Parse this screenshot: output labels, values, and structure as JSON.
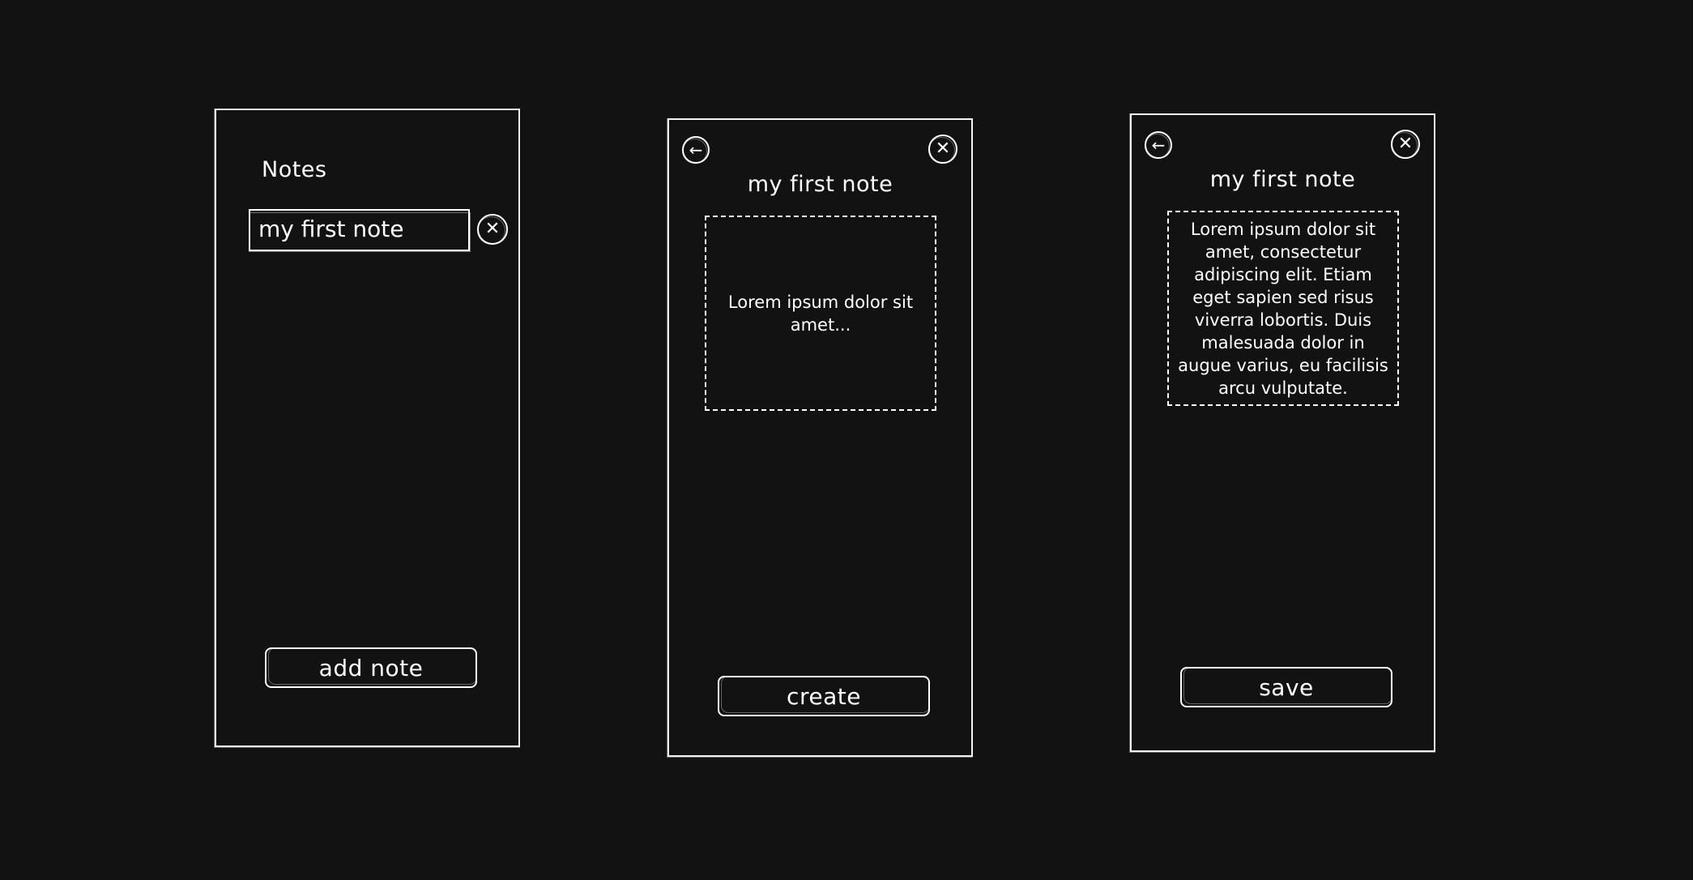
{
  "screens": [
    {
      "title": "Notes",
      "note_item": "my first note",
      "icons": {
        "delete": "close-icon"
      },
      "button_label": "add note"
    },
    {
      "title": "my first note",
      "icons": {
        "back": "back-arrow-icon",
        "close": "close-icon"
      },
      "body_text": "Lorem ipsum dolor sit amet...",
      "button_label": "create"
    },
    {
      "title": "my first note",
      "icons": {
        "back": "back-arrow-icon",
        "close": "close-icon"
      },
      "body_text": "Lorem ipsum dolor sit amet, consectetur adipiscing elit. Etiam eget sapien sed risus viverra lobortis. Duis malesuada dolor in augue varius, eu facilisis arcu vulputate.",
      "button_label": "save"
    }
  ],
  "colors": {
    "background": "#121212",
    "stroke": "#ffffff"
  }
}
